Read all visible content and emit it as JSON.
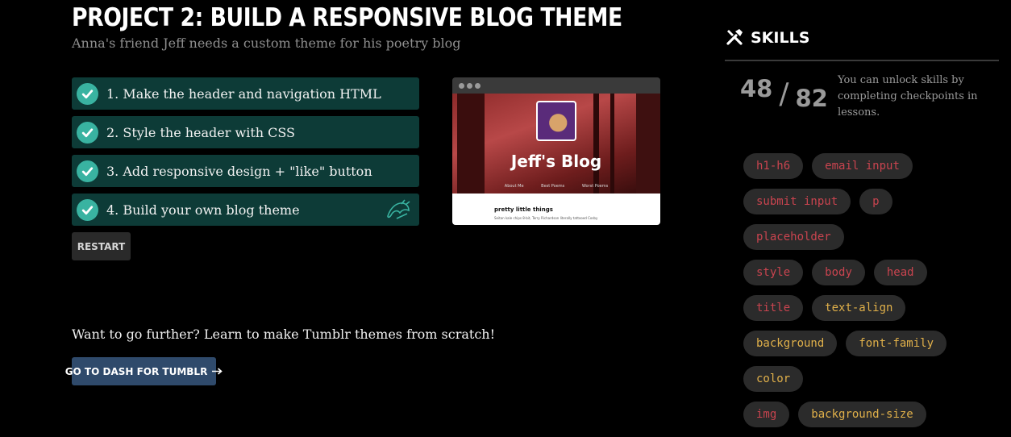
{
  "project": {
    "title": "PROJECT 2: BUILD A RESPONSIVE BLOG THEME",
    "subtitle": "Anna's friend Jeff needs a custom theme for his poetry blog"
  },
  "checkpoints": [
    {
      "label": "1. Make the header and navigation HTML",
      "completed": true
    },
    {
      "label": "2. Style the header with CSS",
      "completed": true
    },
    {
      "label": "3. Add responsive design + \"like\" button",
      "completed": true
    },
    {
      "label": "4. Build your own blog theme",
      "completed": true,
      "extra_icon": "codecademy-bird-icon"
    }
  ],
  "restart_label": "RESTART",
  "preview": {
    "blog_title": "Jeff's Blog",
    "nav": [
      "About Me",
      "Best Poems",
      "Worst Poems"
    ],
    "post_title": "pretty little things",
    "post_text": "Seitan kale chips 8-bit, Terry Richardson literally tattooed Cosby"
  },
  "further": {
    "text": "Want to go further? Learn to make Tumblr themes from scratch!",
    "button_label": "GO TO DASH FOR TUMBLR"
  },
  "skills": {
    "title": "SKILLS",
    "unlocked": "48",
    "separator": "/",
    "total": "82",
    "description": "You can unlock skills by completing checkpoints in lessons.",
    "rows": [
      [
        {
          "name": "h1-h6",
          "color": "#c9444f"
        },
        {
          "name": "email input",
          "color": "#c9444f"
        }
      ],
      [
        {
          "name": "submit input",
          "color": "#c9444f"
        },
        {
          "name": "p",
          "color": "#c9444f"
        }
      ],
      [
        {
          "name": "placeholder",
          "color": "#c9444f"
        }
      ],
      [
        {
          "name": "style",
          "color": "#c9444f"
        },
        {
          "name": "body",
          "color": "#c9444f"
        },
        {
          "name": "head",
          "color": "#c9444f"
        }
      ],
      [
        {
          "name": "title",
          "color": "#c9444f"
        },
        {
          "name": "text-align",
          "color": "#e0b04a"
        }
      ],
      [
        {
          "name": "background",
          "color": "#e0b04a"
        },
        {
          "name": "font-family",
          "color": "#e0b04a"
        }
      ],
      [
        {
          "name": "color",
          "color": "#e0b04a"
        }
      ],
      [
        {
          "name": "img",
          "color": "#c9444f"
        },
        {
          "name": "background-size",
          "color": "#e0b04a"
        }
      ]
    ]
  },
  "colors": {
    "checkpoint_bg": "#0d3b37",
    "check_circle": "#39b3a1",
    "dash_button": "#2f4a6b",
    "html_skill": "#c9444f",
    "css_skill": "#e0b04a"
  }
}
